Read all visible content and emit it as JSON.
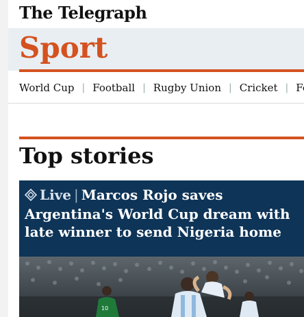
{
  "brand": {
    "name": "The Telegraph"
  },
  "section": {
    "title": "Sport"
  },
  "nav": {
    "items": [
      "World Cup",
      "Football",
      "Rugby Union",
      "Cricket",
      "Form"
    ]
  },
  "top_stories": {
    "heading": "Top stories",
    "lead": {
      "badge": "Live",
      "headline": "Marcos Rojo saves Argentina's World Cup dream with late winner to send Nigeria home",
      "image_icon": "football-celebration-photo"
    }
  },
  "colors": {
    "accent": "#d4521f",
    "section_bg": "#e9eef3",
    "story_bg": "#0e3457"
  }
}
